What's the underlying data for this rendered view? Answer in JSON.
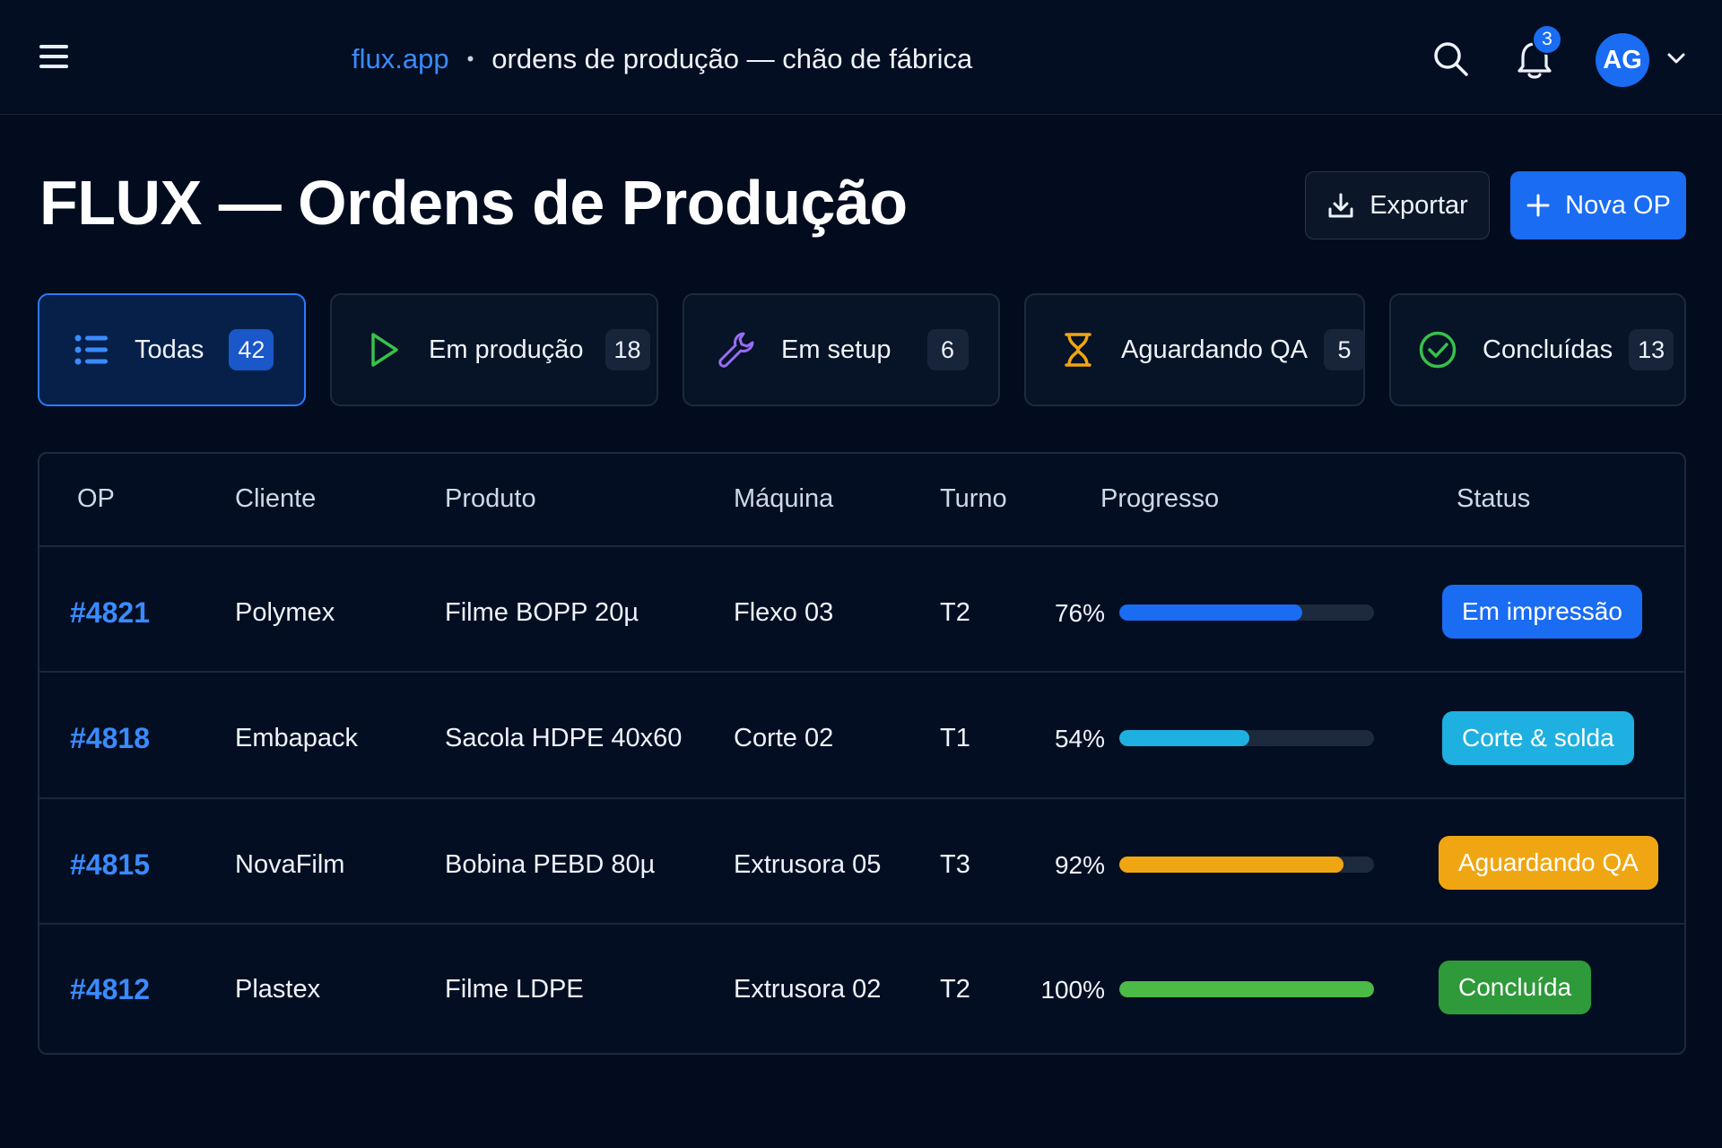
{
  "topbar": {
    "app": "flux.app",
    "separator": "•",
    "page": "ordens de produção — chão de fábrica",
    "notifications": "3",
    "avatar_initials": "AG"
  },
  "header": {
    "title": "FLUX — Ordens de Produção",
    "export_label": "Exportar",
    "new_label": "Nova OP"
  },
  "tabs": [
    {
      "label": "Todas",
      "count": "42",
      "icon": "list-icon",
      "active": true
    },
    {
      "label": "Em produção",
      "count": "18",
      "icon": "play-icon"
    },
    {
      "label": "Em setup",
      "count": "6",
      "icon": "wrench-icon"
    },
    {
      "label": "Aguardando QA",
      "count": "5",
      "icon": "hourglass-icon"
    },
    {
      "label": "Concluídas",
      "count": "13",
      "icon": "check-circle-icon"
    }
  ],
  "table": {
    "headers": [
      "OP",
      "Cliente",
      "Produto",
      "Máquina",
      "Turno",
      "Progresso",
      "Status"
    ],
    "rows": [
      {
        "op": "#4821",
        "client": "Polymex",
        "product": "Filme BOPP 20µ",
        "machine": "Flexo 03",
        "shift": "T2",
        "progress_label": "76%",
        "progress": 0.72,
        "status": "Em impressão"
      },
      {
        "op": "#4818",
        "client": "Embapack",
        "product": "Sacola HDPE 40x60",
        "machine": "Corte 02",
        "shift": "T1",
        "progress_label": "54%",
        "progress": 0.51,
        "status": "Corte & solda"
      },
      {
        "op": "#4815",
        "client": "NovaFilm",
        "product": "Bobina PEBD 80µ",
        "machine": "Extrusora 05",
        "shift": "T3",
        "progress_label": "92%",
        "progress": 0.88,
        "status": "Aguardando QA"
      },
      {
        "op": "#4812",
        "client": "Plastex",
        "product": "Filme LDPE",
        "machine": "Extrusora 02",
        "shift": "T2",
        "progress_label": "100%",
        "progress": 1.0,
        "status": "Concluída"
      }
    ]
  },
  "colors": {
    "accent": "#1a6cf2",
    "printing": "#1a6cf2",
    "cutting": "#1eb0e0",
    "qa": "#f0a612",
    "done": "#2e9a3a",
    "done_bar": "#4cba46"
  }
}
